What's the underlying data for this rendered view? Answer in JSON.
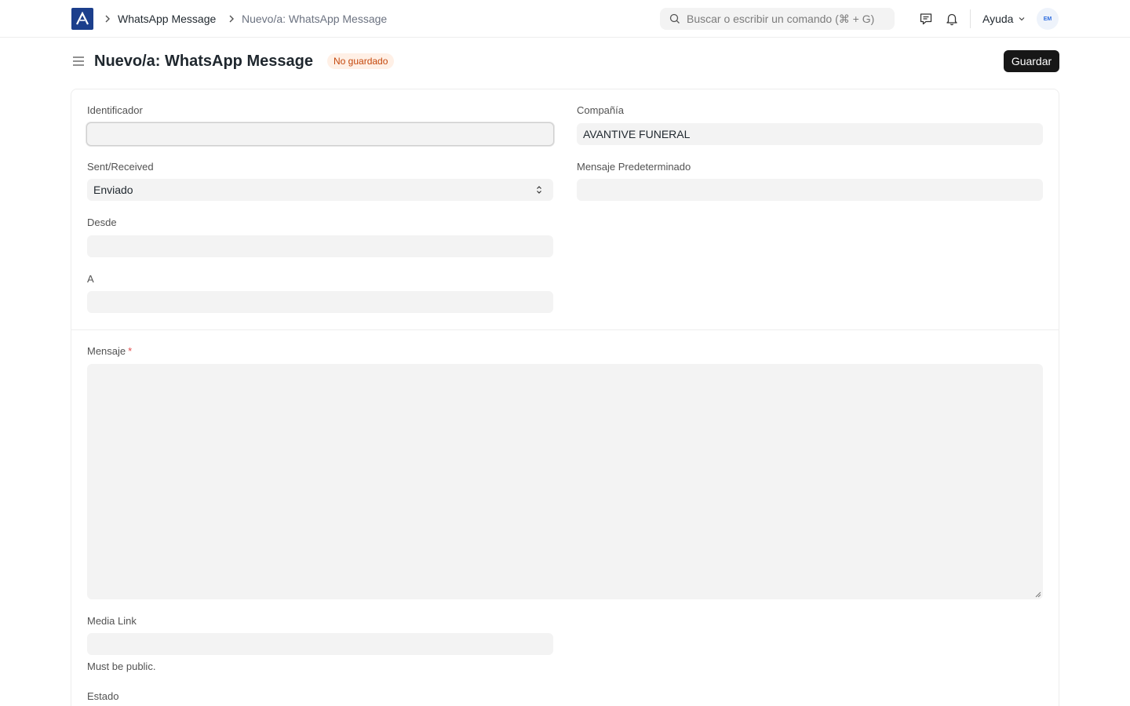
{
  "navbar": {
    "breadcrumbs": [
      "WhatsApp Message",
      "Nuevo/a: WhatsApp Message"
    ],
    "search_placeholder": "Buscar o escribir un comando (⌘ + G)",
    "help_label": "Ayuda",
    "avatar_initials": "EM"
  },
  "page": {
    "title": "Nuevo/a: WhatsApp Message",
    "status": "No guardado",
    "save_label": "Guardar"
  },
  "form": {
    "identificador": {
      "label": "Identificador",
      "value": ""
    },
    "compania": {
      "label": "Compañía",
      "value": "AVANTIVE FUNERAL"
    },
    "sent_received": {
      "label": "Sent/Received",
      "value": "Enviado"
    },
    "mensaje_predeterminado": {
      "label": "Mensaje Predeterminado",
      "value": ""
    },
    "desde": {
      "label": "Desde",
      "value": ""
    },
    "a": {
      "label": "A",
      "value": ""
    },
    "mensaje": {
      "label": "Mensaje",
      "required_mark": "*",
      "value": ""
    },
    "media_link": {
      "label": "Media Link",
      "value": "",
      "description": "Must be public."
    },
    "estado": {
      "label": "Estado"
    }
  },
  "colors": {
    "primary_button": "#171717",
    "status_bg": "#fff0e6",
    "status_text": "#c4470b",
    "logo_bg": "#1c3f8c"
  }
}
